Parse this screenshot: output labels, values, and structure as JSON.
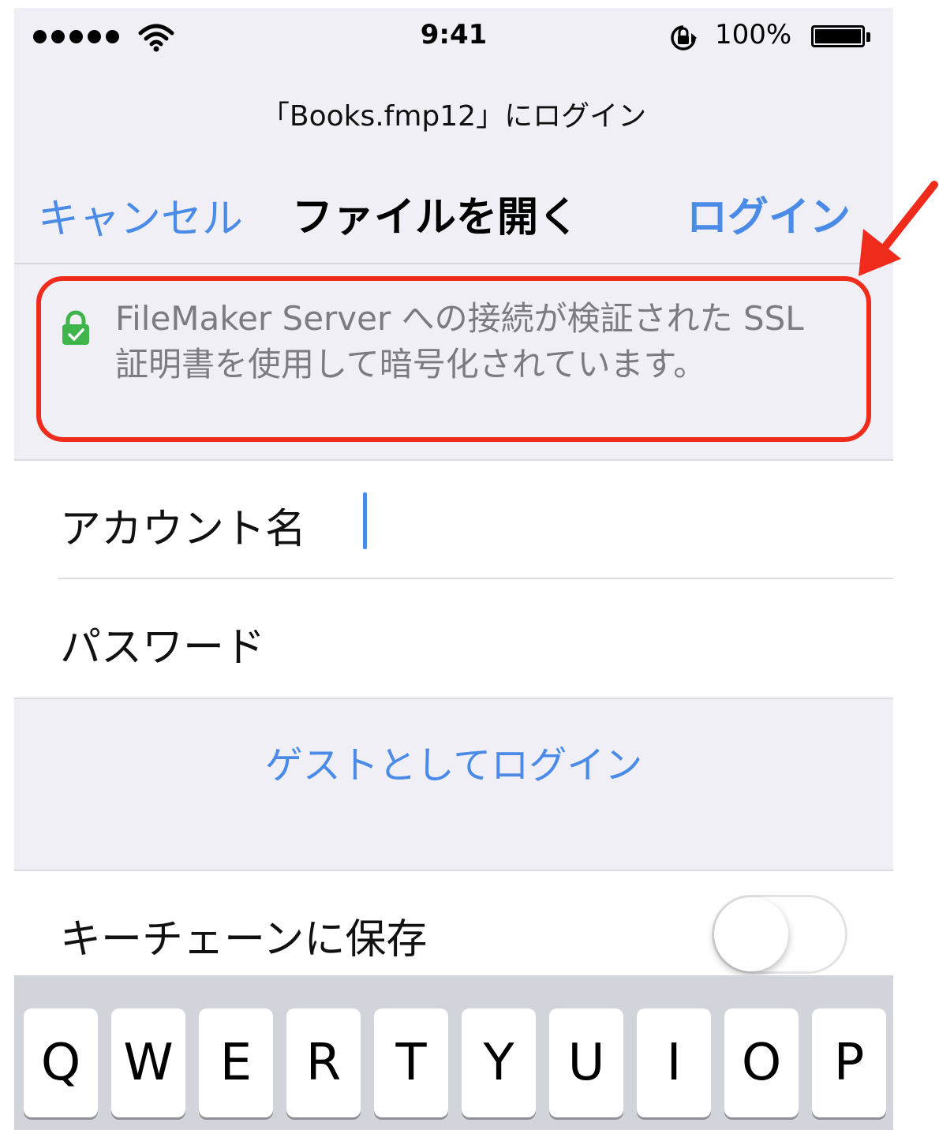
{
  "status_bar": {
    "time": "9:41",
    "battery_percent": "100%",
    "battery_level": 1.0,
    "signal_bars": 5
  },
  "prompt": "「Books.fmp12」にログイン",
  "nav": {
    "cancel_label": "キャンセル",
    "title": "ファイルを開く",
    "login_label": "ログイン"
  },
  "ssl_notice": {
    "text": "FileMaker Server への接続が検証された SSL 証明書を使用して暗号化されています。",
    "lock_color": "#3fb54b"
  },
  "form": {
    "account_label": "アカウント名",
    "account_value": "",
    "password_label": "パスワード",
    "password_value": ""
  },
  "guest_login_label": "ゲストとしてログイン",
  "keychain": {
    "label": "キーチェーンに保存",
    "enabled": false
  },
  "keyboard": {
    "row1": [
      "Q",
      "W",
      "E",
      "R",
      "T",
      "Y",
      "U",
      "I",
      "O",
      "P"
    ]
  },
  "colors": {
    "accent": "#4a8be8",
    "annotation": "#ef2b1c",
    "background": "#f0eff5"
  }
}
